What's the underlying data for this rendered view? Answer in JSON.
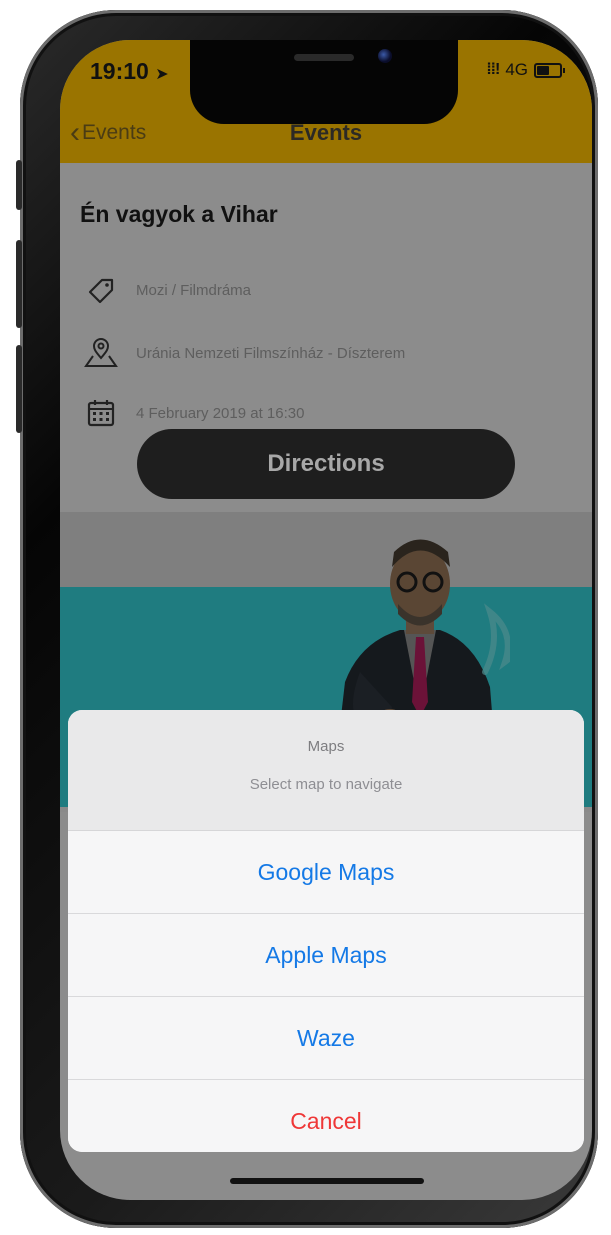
{
  "status_bar": {
    "time": "19:10",
    "network": "4G"
  },
  "nav": {
    "back_label": "Events",
    "title": "Events"
  },
  "event": {
    "title": "Én vagyok a Vihar",
    "category": "Mozi / Filmdráma",
    "venue": "Uránia Nemzeti Filmszínház - Díszterem",
    "datetime": "4 February 2019 at 16:30",
    "directions_label": "Directions"
  },
  "action_sheet": {
    "title": "Maps",
    "message": "Select map to navigate",
    "options": [
      "Google Maps",
      "Apple Maps",
      "Waze"
    ],
    "cancel_label": "Cancel"
  },
  "colors": {
    "header": "#9a7400",
    "action_blue": "#1479e6",
    "cancel_red": "#ef3737",
    "poster_teal": "#1f7c80"
  },
  "icons": [
    "location-arrow-icon",
    "signal-icon",
    "battery-icon",
    "chevron-left-icon",
    "tag-icon",
    "map-pin-icon",
    "calendar-icon"
  ]
}
